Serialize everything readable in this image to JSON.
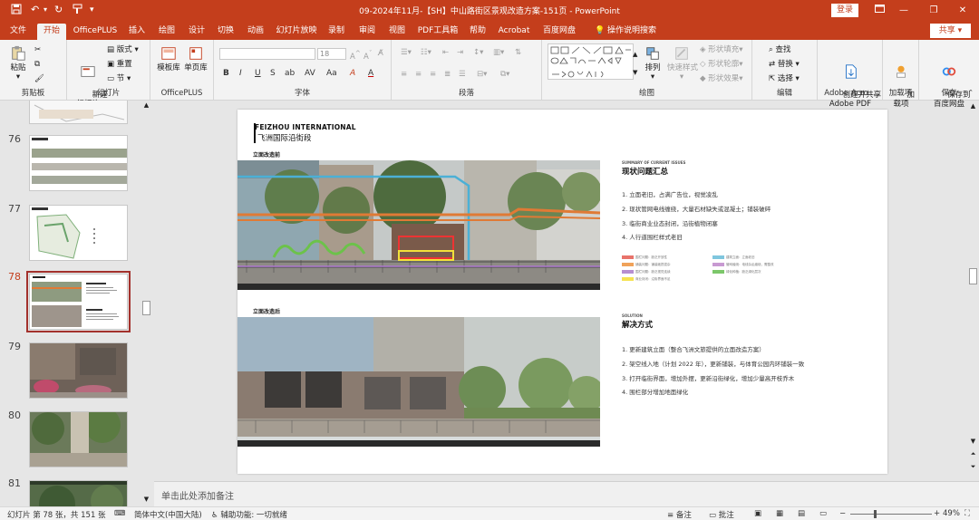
{
  "window": {
    "title": "09-2024年11月-【SH】中山路街区景观改造方案-151页  -  PowerPoint",
    "login_label": "登录",
    "share_label": "共享"
  },
  "tabs": [
    "文件",
    "开始",
    "OfficePLUS",
    "插入",
    "绘图",
    "设计",
    "切换",
    "动画",
    "幻灯片放映",
    "录制",
    "审阅",
    "视图",
    "PDF工具箱",
    "帮助",
    "Acrobat",
    "百度网盘"
  ],
  "tell_me": "操作说明搜索",
  "ribbon": {
    "clipboard": {
      "paste": "粘贴",
      "label": "剪贴板"
    },
    "slides": {
      "new_slide": "新建\n幻灯片",
      "layout": "版式",
      "reset": "重置",
      "section": "节",
      "label": "幻灯片"
    },
    "officeplus": {
      "template": "模板库",
      "single": "单页库",
      "label": "OfficePLUS"
    },
    "font": {
      "size": "18",
      "label": "字体",
      "buttons": [
        "B",
        "I",
        "U",
        "S",
        "ab",
        "AV",
        "Aa",
        "A",
        "A"
      ]
    },
    "paragraph": {
      "label": "段落"
    },
    "drawing": {
      "arrange": "排列",
      "quick_styles": "快速样式",
      "fill": "形状填充",
      "outline": "形状轮廓",
      "effects": "形状效果",
      "label": "绘图"
    },
    "editing": {
      "find": "查找",
      "replace": "替换",
      "select": "选择",
      "label": "编辑"
    },
    "adobe": {
      "create": "创建并共享\nAdobe PDF",
      "label": "Adobe Acro..."
    },
    "addins": {
      "btn": "加\n载项",
      "label": "加载项"
    },
    "save": {
      "btn": "保存到\n百度网盘",
      "label": "保存"
    }
  },
  "thumbnails": [
    {
      "num": "76"
    },
    {
      "num": "77"
    },
    {
      "num": "78",
      "selected": true
    },
    {
      "num": "79"
    },
    {
      "num": "80"
    },
    {
      "num": "81"
    }
  ],
  "slide": {
    "brand_en": "FEIZHOU INTERNATIONAL",
    "brand_cn": "飞洲国际沿街段",
    "before_label": "立面改造前",
    "after_label": "立面改造后",
    "issues_en": "SUMMARY OF CURRENT ISSUES",
    "issues_cn": "现状问题汇总",
    "issues": [
      "1. 立面老旧，占满广告位，视觉凌乱",
      "2. 现状管网电线缠绕，大量石材缺失或混凝土；铺装破碎",
      "3. 临街商业业态封闭，沿街植物闭塞",
      "4. 人行道围栏样式老旧"
    ],
    "legend": [
      {
        "color": "#e8736b",
        "text": "围栏问题：缺乏开放性"
      },
      {
        "color": "#f0a25a",
        "text": "铺装问题：铺装破损混杂"
      },
      {
        "color": "#b78fd0",
        "text": "围栏问题：缺乏视觉连续"
      },
      {
        "color": "#f5e251",
        "text": "商业封闭：沿街界面不足"
      },
      {
        "color": "#7fc6de",
        "text": "建筑立面：立面老旧"
      },
      {
        "color": "#c89ad2",
        "text": "管网缠绕：电线杂乱缠绕，需整改"
      },
      {
        "color": "#7cc76a",
        "text": "绿化种植：缺乏绿化层次"
      }
    ],
    "solution_en": "SOLUTION",
    "solution_cn": "解决方式",
    "solutions": [
      "1. 更新建筑立面（整合飞洲文旅提供的立面改造方案）",
      "2. 架空线入地（计划 2022 年），更新铺装，与体育公园内环铺装一致",
      "3. 打开临街界面，增加外摆，更新沿街绿化，增加少量高开枝乔木",
      "4. 围栏部分增加地面绿化"
    ]
  },
  "notes_placeholder": "单击此处添加备注",
  "status": {
    "slide_info": "幻灯片 第 78 张，共 151 张",
    "language": "简体中文(中国大陆)",
    "accessibility": "辅助功能: 一切就绪",
    "notes": "备注",
    "comments": "批注",
    "zoom": "49%"
  },
  "colors": {
    "accent": "#c43e1c",
    "selected_thumb": "#a3312c"
  }
}
